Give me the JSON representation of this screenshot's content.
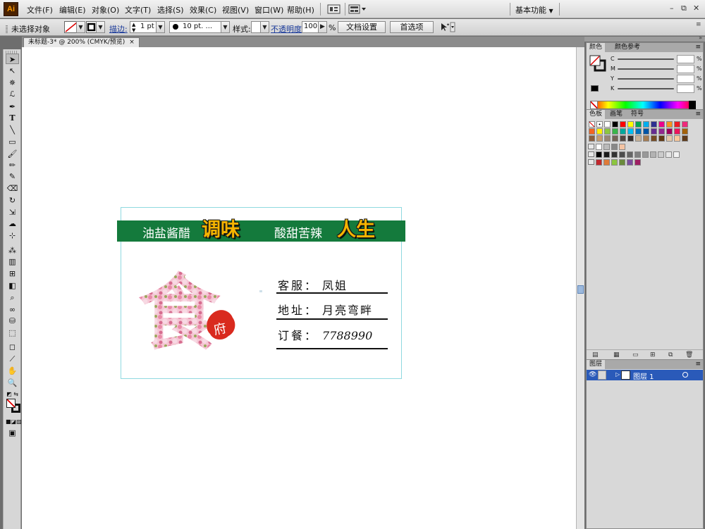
{
  "app": {
    "logo": "Ai"
  },
  "menu": [
    "文件(F)",
    "编辑(E)",
    "对象(O)",
    "文字(T)",
    "选择(S)",
    "效果(C)",
    "视图(V)",
    "窗口(W)",
    "帮助(H)"
  ],
  "workspace": {
    "label": "基本功能",
    "arrow": "▼"
  },
  "window_controls": {
    "minimize": "–",
    "restore": "⧉",
    "close": "✕"
  },
  "control_bar": {
    "selection_status": "未选择对象",
    "stroke_label": "描边:",
    "stroke_weight": "1 pt",
    "brush_size": "10 pt. ...",
    "style_label": "样式:",
    "opacity_label": "不透明度:",
    "opacity_value": "100",
    "opacity_unit": "%",
    "doc_setup_button": "文档设置",
    "preferences_button": "首选项"
  },
  "document_tab": {
    "title": "未标题-3* @ 200% (CMYK/预览)",
    "close": "×"
  },
  "tools": [
    "selection-arrow",
    "direct-selection",
    "magic-wand",
    "lasso",
    "pen",
    "type",
    "line-segment",
    "rectangle",
    "paintbrush",
    "pencil",
    "blob-brush",
    "eraser",
    "rotate",
    "scale",
    "warp",
    "free-transform",
    "symbol-sprayer",
    "column-graph",
    "mesh",
    "gradient",
    "eyedropper",
    "blend",
    "live-paint-bucket",
    "live-paint-selection",
    "artboard",
    "slice",
    "hand",
    "zoom"
  ],
  "card": {
    "slogan_1": "油盐酱醋",
    "slogan_big_1": "调味",
    "slogan_2": "酸甜苦辣",
    "slogan_big_2": "人生",
    "logo_glyph": "食",
    "logo_stamp": "府",
    "rows": [
      {
        "label": "客服：",
        "value": "凤姐"
      },
      {
        "label": "地址：",
        "value": "月亮弯畔"
      },
      {
        "label": "订餐：",
        "value": "7788990"
      }
    ],
    "colors": {
      "band": "#147a3c",
      "accent": "#f5b400",
      "stamp": "#d92a1e",
      "blossom": "#f0b6c8"
    }
  },
  "color_panel": {
    "tabs": [
      "颜色",
      "颜色参考"
    ],
    "channels": [
      {
        "label": "C",
        "unit": "%"
      },
      {
        "label": "M",
        "unit": "%"
      },
      {
        "label": "Y",
        "unit": "%"
      },
      {
        "label": "K",
        "unit": "%"
      }
    ]
  },
  "swatches_panel": {
    "tabs": [
      "色板",
      "画笔",
      "符号"
    ]
  },
  "layers_panel": {
    "tab": "图层",
    "layer_name": "图层 1"
  }
}
